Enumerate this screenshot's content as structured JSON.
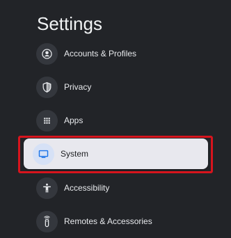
{
  "page": {
    "title": "Settings"
  },
  "menu": {
    "items": [
      {
        "label": "Accounts & Profiles",
        "icon": "account-circle-icon"
      },
      {
        "label": "Privacy",
        "icon": "shield-icon"
      },
      {
        "label": "Apps",
        "icon": "apps-grid-icon"
      },
      {
        "label": "System",
        "icon": "tv-monitor-icon",
        "selected": true
      },
      {
        "label": "Accessibility",
        "icon": "accessibility-icon"
      },
      {
        "label": "Remotes & Accessories",
        "icon": "remote-icon"
      }
    ]
  },
  "colors": {
    "background": "#222428",
    "selection_highlight": "#d7141d",
    "selected_card": "#e8e8ee",
    "icon_accent": "#1a73e8"
  }
}
